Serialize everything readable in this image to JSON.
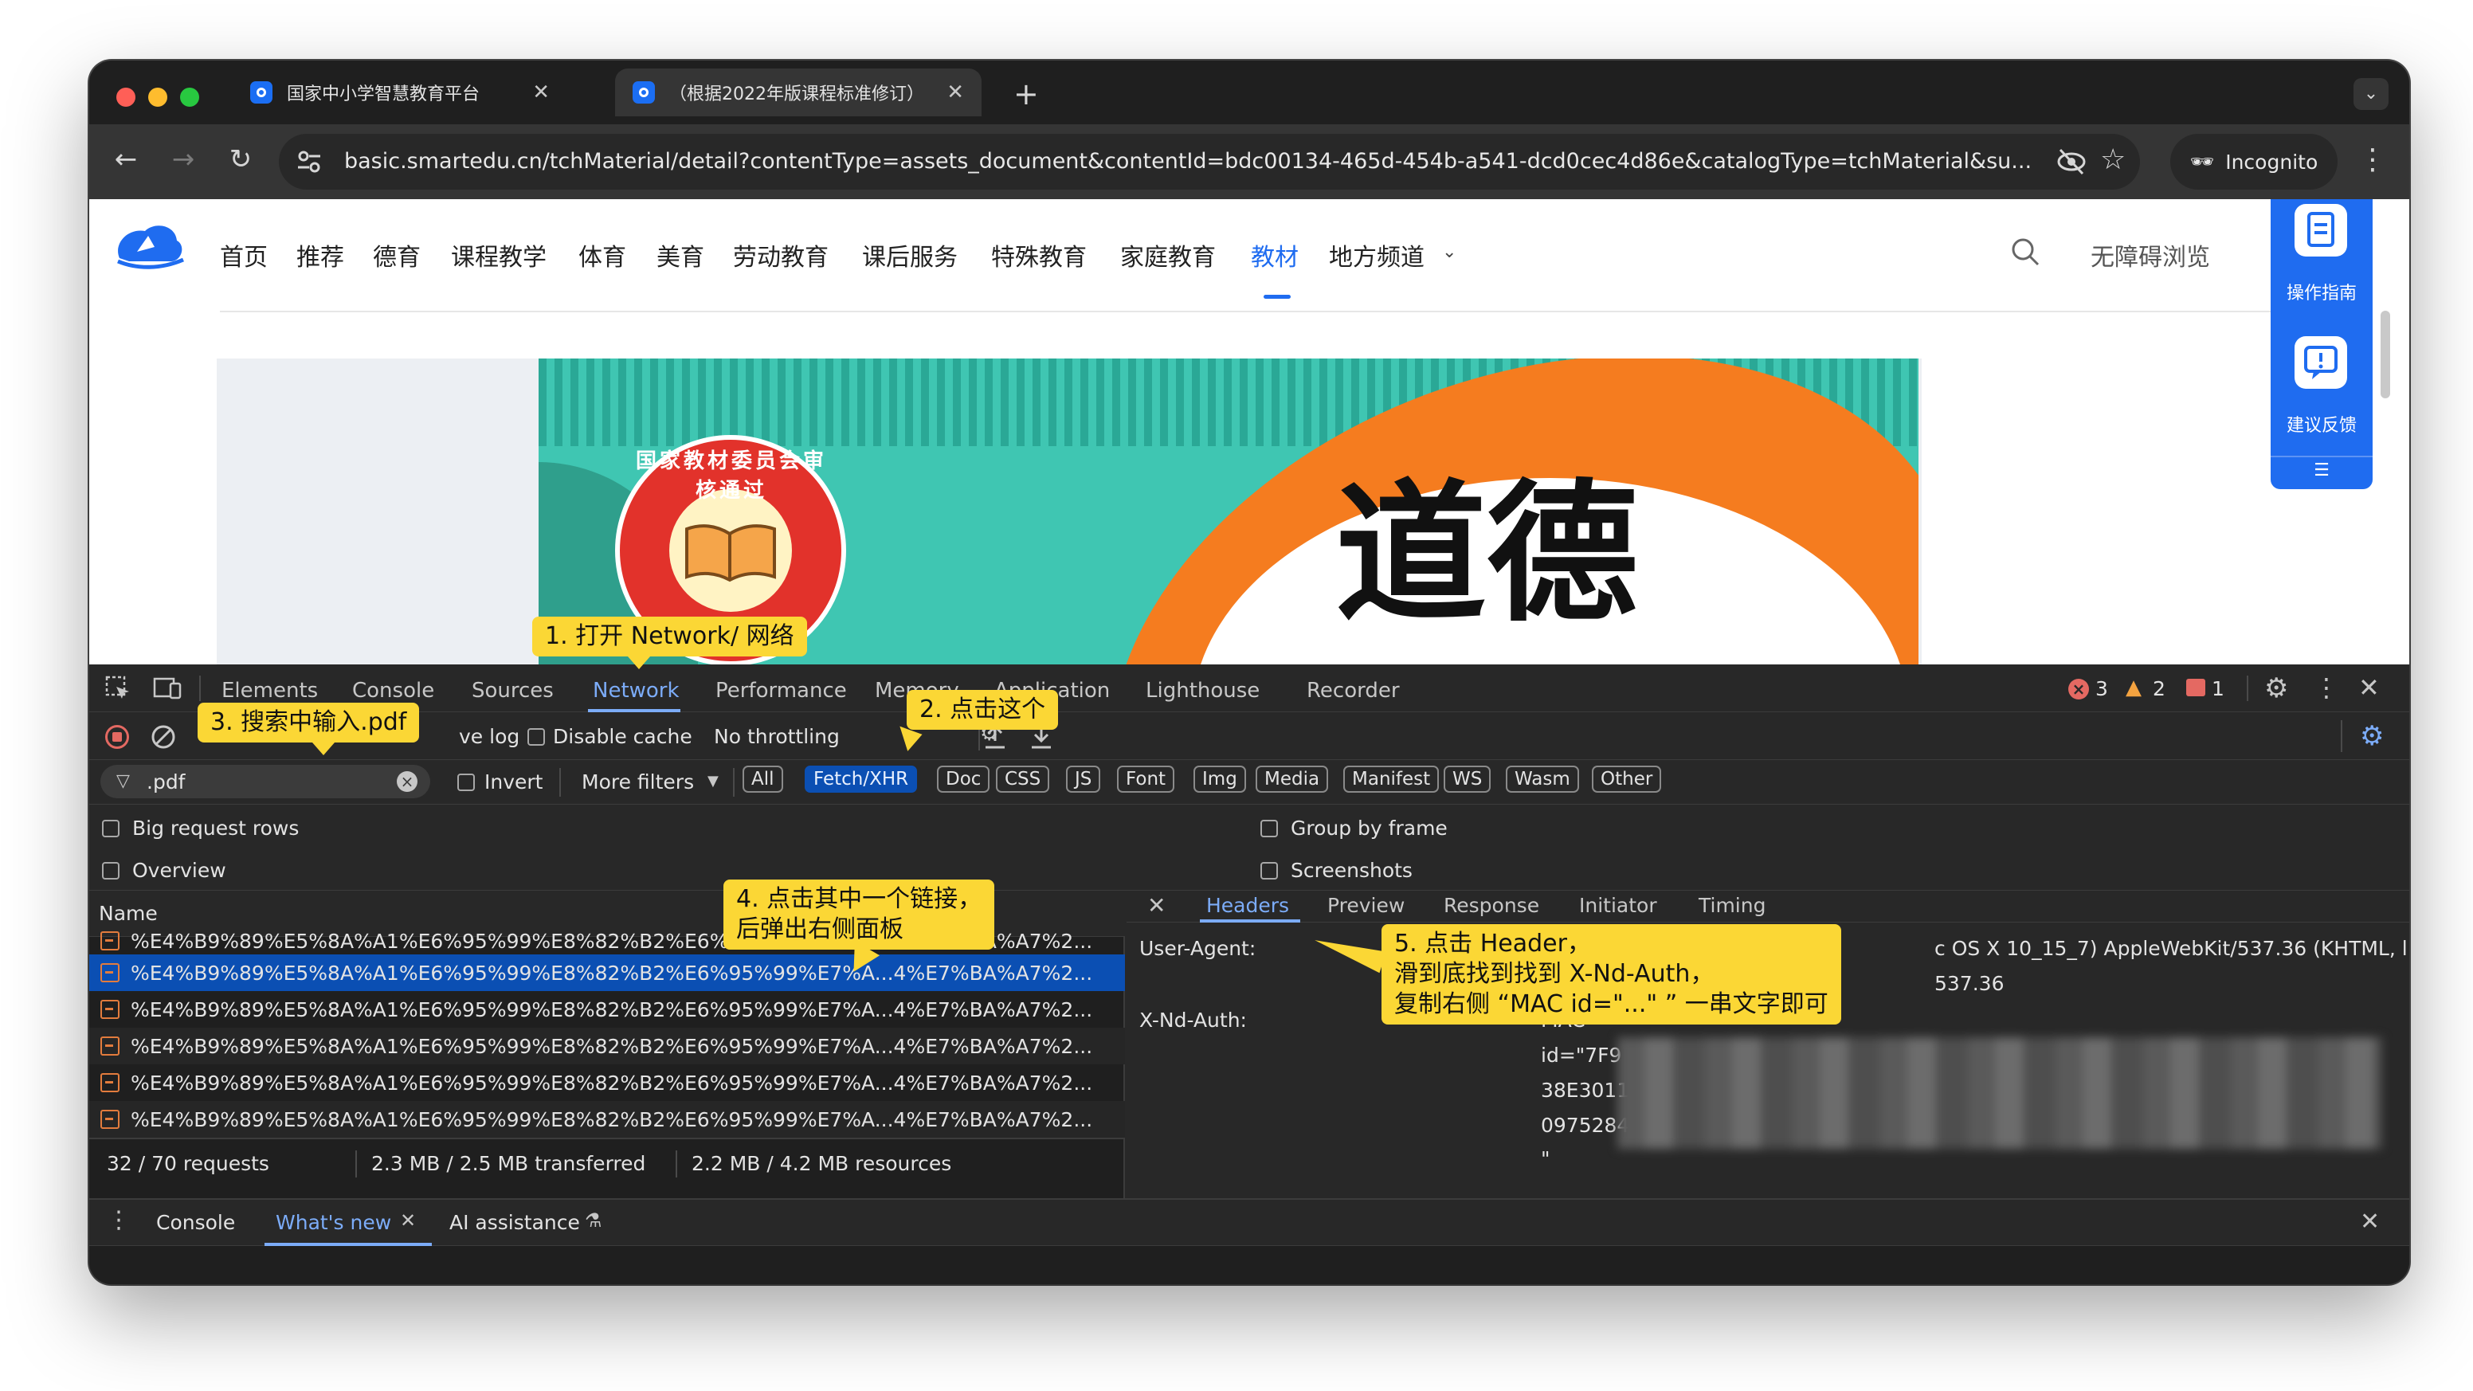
{
  "browser": {
    "tabs": [
      {
        "title": "国家中小学智慧教育平台"
      },
      {
        "title": "（根据2022年版课程标准修订）"
      }
    ],
    "new_tab": "+",
    "close_glyph": "✕",
    "url": "basic.smartedu.cn/tchMaterial/detail?contentType=assets_document&contentId=bdc00134-465d-454b-a541-dcd0cec4d86e&catalogType=tchMaterial&su...",
    "incognito_label": "Incognito"
  },
  "site": {
    "nav": [
      "首页",
      "推荐",
      "德育",
      "课程教学",
      "体育",
      "美育",
      "劳动教育",
      "课后服务",
      "特殊教育",
      "家庭教育",
      "教材",
      "地方频道"
    ],
    "active_nav": "教材",
    "accessibility": "无障碍浏览",
    "side_panel": {
      "guide": "操作指南",
      "feedback": "建议反馈",
      "menu_glyph": "☰"
    },
    "cover": {
      "seal_text": "国家教材委员会审核通过",
      "title": "道德"
    }
  },
  "devtools": {
    "tabs": [
      "Elements",
      "Console",
      "Sources",
      "Network",
      "Performance",
      "Memory",
      "Application",
      "Lighthouse",
      "Recorder"
    ],
    "selected_tab": "Network",
    "counts": {
      "errors": "3",
      "warnings": "2",
      "issues": "1"
    },
    "toolbar": {
      "preserve_log": "ve log",
      "disable_cache": "Disable cache",
      "throttling": "No throttling"
    },
    "filter": {
      "value": ".pdf",
      "invert": "Invert",
      "more_filters": "More filters"
    },
    "type_filters": [
      "All",
      "Fetch/XHR",
      "Doc",
      "CSS",
      "JS",
      "Font",
      "Img",
      "Media",
      "Manifest",
      "WS",
      "Wasm",
      "Other"
    ],
    "selected_type": "Fetch/XHR",
    "options": {
      "big_rows": "Big request rows",
      "group_by_frame": "Group by frame",
      "overview": "Overview",
      "screenshots": "Screenshots"
    },
    "name_header": "Name",
    "requests": [
      "%E4%B9%89%E5%8A%A1%E6%95%99%E8%82%B2%E6%95%99%E7%A...4%E7%BA%A7%2...",
      "%E4%B9%89%E5%8A%A1%E6%95%99%E8%82%B2%E6%95%99%E7%A...4%E7%BA%A7%2...",
      "%E4%B9%89%E5%8A%A1%E6%95%99%E8%82%B2%E6%95%99%E7%A...4%E7%BA%A7%2...",
      "%E4%B9%89%E5%8A%A1%E6%95%99%E8%82%B2%E6%95%99%E7%A...4%E7%BA%A7%2...",
      "%E4%B9%89%E5%8A%A1%E6%95%99%E8%82%B2%E6%95%99%E7%A...4%E7%BA%A7%2...",
      "%E4%B9%89%E5%8A%A1%E6%95%99%E8%82%B2%E6%95%99%E7%A...4%E7%BA%A7%2..."
    ],
    "summary": {
      "requests": "32 / 70 requests",
      "transferred": "2.3 MB / 2.5 MB transferred",
      "resources": "2.2 MB / 4.2 MB resources"
    },
    "detail": {
      "tabs": [
        "Headers",
        "Preview",
        "Response",
        "Initiator",
        "Timing"
      ],
      "selected": "Headers",
      "user_agent_label": "User-Agent:",
      "user_agent_value_1": "c OS X 10_15_7) AppleWebKit/537.36 (KHTML, like",
      "user_agent_value_2": "537.36",
      "auth_label": "X-Nd-Auth:",
      "auth_lines": [
        "MAC",
        "id=\"7F9",
        "38E3011",
        "0975284",
        "\""
      ]
    },
    "drawer": {
      "tabs": [
        "Console",
        "What's new",
        "AI assistance"
      ],
      "selected": "What's new"
    }
  },
  "annotations": [
    {
      "id": "1",
      "lines": [
        "1. 打开 Network/ 网络"
      ]
    },
    {
      "id": "2",
      "lines": [
        "2. 点击这个"
      ]
    },
    {
      "id": "3",
      "lines": [
        "3. 搜索中输入.pdf"
      ]
    },
    {
      "id": "4",
      "lines": [
        "4. 点击其中一个链接，",
        "后弹出右侧面板"
      ]
    },
    {
      "id": "5",
      "lines": [
        "5. 点击 Header，",
        "滑到底找到找到 X-Nd-Auth，",
        "复制右侧 “MAC id=\"...\" ” 一串文字即可"
      ]
    }
  ],
  "colors": {
    "accent": "#1f6cf0",
    "callout": "#fbd735",
    "devtools_bg": "#282828",
    "selected_row": "#0b4fb3"
  }
}
